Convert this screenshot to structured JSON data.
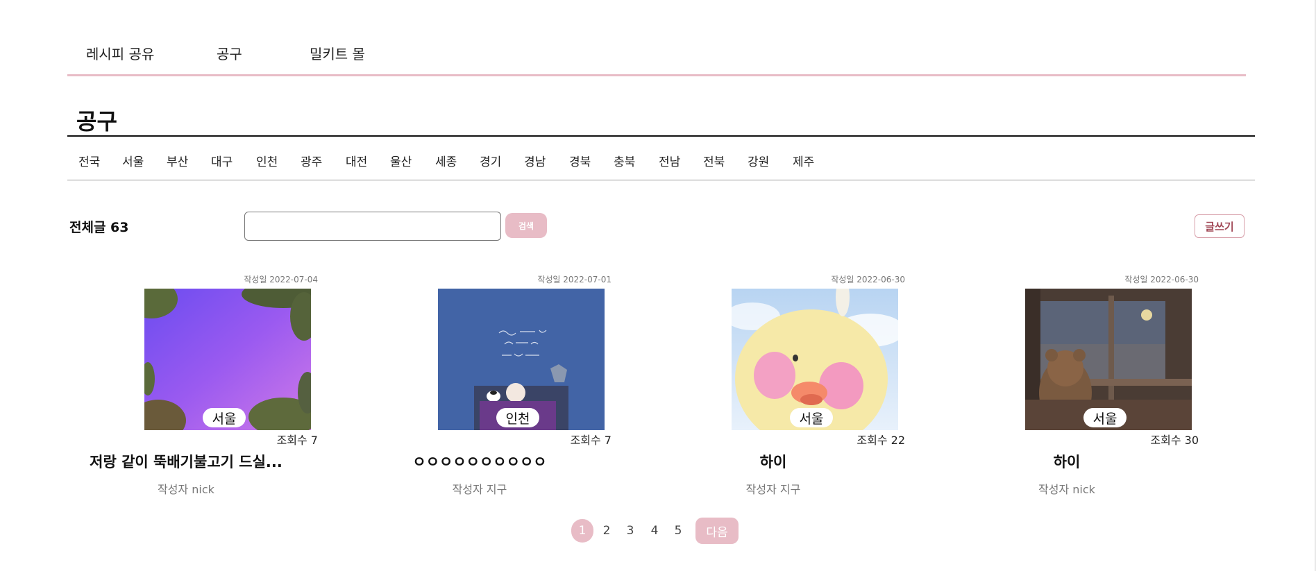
{
  "nav": {
    "recipe": "레시피 공유",
    "group": "공구",
    "mealkit": "밀키트 몰"
  },
  "page_title": "공구",
  "regions": [
    "전국",
    "서울",
    "부산",
    "대구",
    "인천",
    "광주",
    "대전",
    "울산",
    "세종",
    "경기",
    "경남",
    "경북",
    "충북",
    "전남",
    "전북",
    "강원",
    "제주"
  ],
  "toolbar": {
    "total_label": "전체글 63",
    "search_value": "",
    "search_button": "검색",
    "write_button": "글쓰기"
  },
  "posts": [
    {
      "date": "작성일 2022-07-04",
      "region": "서울",
      "views": "조회수 7",
      "title": "저랑 같이 뚝배기불고기 드실...",
      "author": "작성자 nick"
    },
    {
      "date": "작성일 2022-07-01",
      "region": "인천",
      "views": "조회수 7",
      "title": "ㅇㅇㅇㅇㅇㅇㅇㅇㅇㅇ",
      "author": "작성자 지구"
    },
    {
      "date": "작성일 2022-06-30",
      "region": "서울",
      "views": "조회수 22",
      "title": "하이",
      "author": "작성자 지구"
    },
    {
      "date": "작성일 2022-06-30",
      "region": "서울",
      "views": "조회수 30",
      "title": "하이",
      "author": "작성자 nick"
    }
  ],
  "pagination": {
    "pages": [
      "1",
      "2",
      "3",
      "4",
      "5"
    ],
    "current": "1",
    "next": "다음"
  },
  "colors": {
    "accent": "#e8bcc6",
    "write_border": "#d79ea9"
  }
}
